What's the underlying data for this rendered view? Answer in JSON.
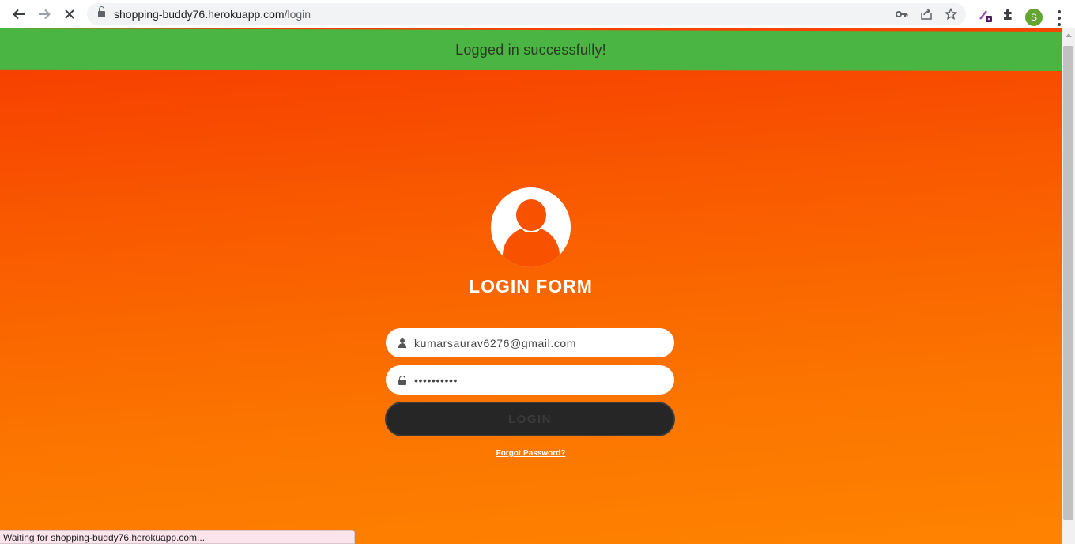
{
  "browser": {
    "url_host": "shopping-buddy76.herokuapp.com",
    "url_path": "/login",
    "profile_initial": "S",
    "status_text": "Waiting for shopping-buddy76.herokuapp.com..."
  },
  "banner": {
    "message": "Logged in successfully!",
    "color": "#4bb543"
  },
  "login": {
    "title": "LOGIN FORM",
    "email_value": "kumarsaurav6276@gmail.com",
    "password_value": "••••••••••",
    "button_label": "LOGIN",
    "forgot_label": "Forgot Password?"
  },
  "icons": [
    "back-icon",
    "forward-icon",
    "stop-icon",
    "lock-icon",
    "key-icon",
    "share-icon",
    "star-icon",
    "eyedropper-extension-icon",
    "puzzle-icon",
    "user-icon",
    "password-lock-icon"
  ],
  "colors": {
    "gradient_top": "#f63a00",
    "gradient_bottom": "#ff8300",
    "button_bg": "#262626"
  }
}
